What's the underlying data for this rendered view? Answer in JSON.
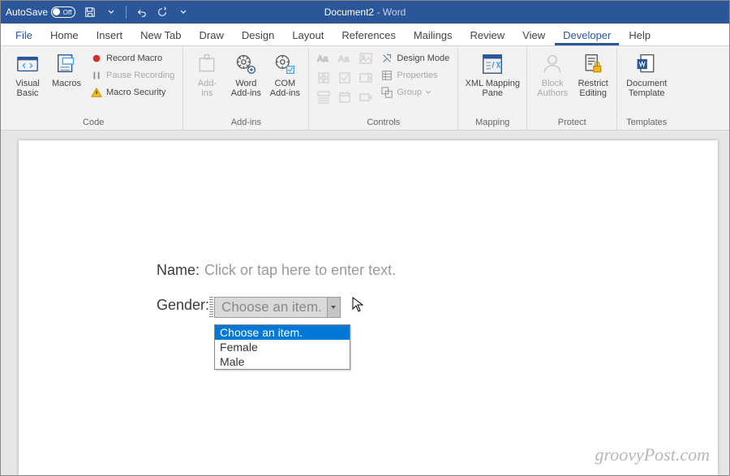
{
  "titlebar": {
    "autosave_label": "AutoSave",
    "autosave_state": "Off",
    "doc_title": "Document2",
    "app_hint": "-  Word"
  },
  "tabs": {
    "file": "File",
    "home": "Home",
    "insert": "Insert",
    "newtab": "New Tab",
    "draw": "Draw",
    "design": "Design",
    "layout": "Layout",
    "references": "References",
    "mailings": "Mailings",
    "review": "Review",
    "view": "View",
    "developer": "Developer",
    "help": "Help"
  },
  "ribbon": {
    "code": {
      "label": "Code",
      "visual_basic": "Visual\nBasic",
      "macros": "Macros",
      "record_macro": "Record Macro",
      "pause_recording": "Pause Recording",
      "macro_security": "Macro Security"
    },
    "addins": {
      "label": "Add-ins",
      "addins": "Add-\nins",
      "word_addins": "Word\nAdd-ins",
      "com_addins": "COM\nAdd-ins"
    },
    "controls": {
      "label": "Controls",
      "design_mode": "Design Mode",
      "properties": "Properties",
      "group": "Group"
    },
    "mapping": {
      "label": "Mapping",
      "xml_mapping": "XML Mapping\nPane"
    },
    "protect": {
      "label": "Protect",
      "block_authors": "Block\nAuthors",
      "restrict_editing": "Restrict\nEditing"
    },
    "templates": {
      "label": "Templates",
      "document_template": "Document\nTemplate"
    }
  },
  "document": {
    "name_label": "Name:",
    "name_placeholder": "Click or tap here to enter text.",
    "gender_label": "Gender:",
    "gender_current": "Choose an item.",
    "gender_options": {
      "o0": "Choose an item.",
      "o1": "Female",
      "o2": "Male"
    }
  },
  "watermark": "groovyPost.com"
}
